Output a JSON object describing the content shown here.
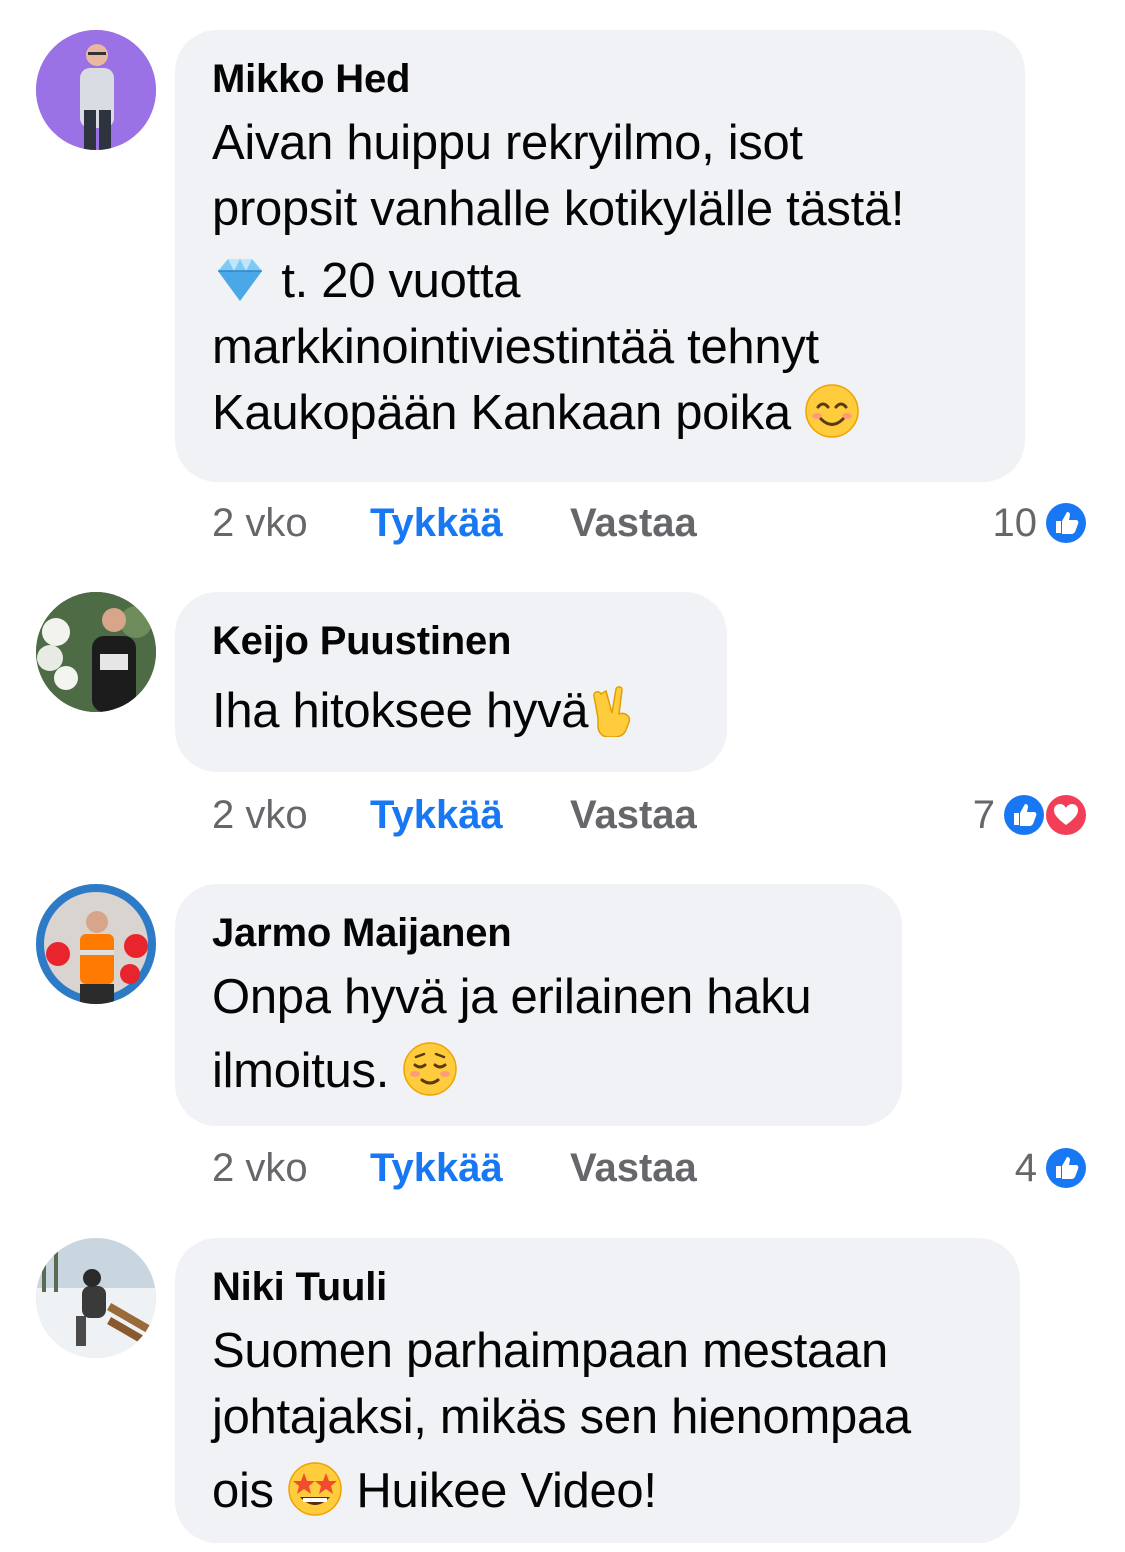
{
  "comments": [
    {
      "author": "Mikko Hed",
      "lines": [
        "Aivan huippu rekryilmo, isot",
        "propsit vanhalle kotikylälle tästä!",
        "t. 20 vuotta",
        "markkinointiviestintää tehnyt",
        "Kaukopään Kankaan poika"
      ],
      "emojis": [
        "gem-emoji",
        "smiling-face-emoji"
      ],
      "time": "2 vko",
      "like_label": "Tykkää",
      "reply_label": "Vastaa",
      "reaction_count": "10",
      "reactions": [
        "like"
      ]
    },
    {
      "author": "Keijo Puustinen",
      "lines": [
        "Iha hitoksee hyvä"
      ],
      "emojis": [
        "victory-hand-emoji"
      ],
      "time": "2 vko",
      "like_label": "Tykkää",
      "reply_label": "Vastaa",
      "reaction_count": "7",
      "reactions": [
        "like",
        "love"
      ]
    },
    {
      "author": "Jarmo Maijanen",
      "lines": [
        "Onpa hyvä ja erilainen haku",
        "ilmoitus."
      ],
      "emojis": [
        "relieved-face-emoji"
      ],
      "time": "2 vko",
      "like_label": "Tykkää",
      "reply_label": "Vastaa",
      "reaction_count": "4",
      "reactions": [
        "like"
      ]
    },
    {
      "author": "Niki Tuuli",
      "lines": [
        "Suomen parhaimpaan mestaan",
        "johtajaksi, mikäs sen hienompaa",
        "ois",
        "Huikee Video!"
      ],
      "emojis": [
        "star-struck-emoji"
      ]
    }
  ],
  "colors": {
    "bubble": "#f0f2f5",
    "like_blue": "#1877f2",
    "meta_gray": "#65676b",
    "love_red": "#f33e58"
  }
}
